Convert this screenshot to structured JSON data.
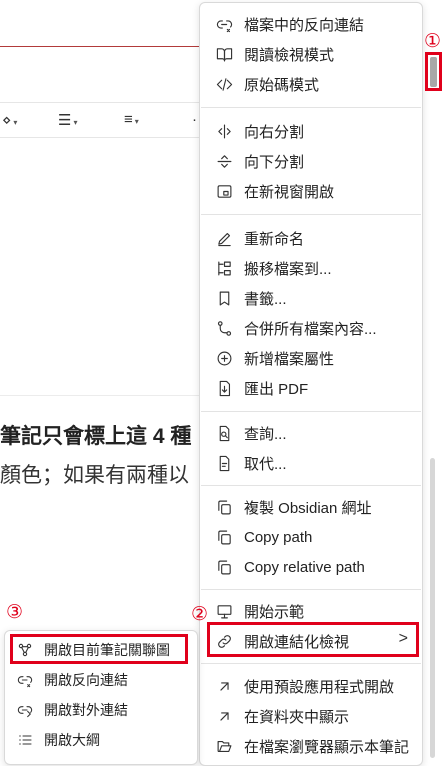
{
  "toolbar": {
    "items": [
      "⋄",
      "☰",
      "≡",
      "·"
    ]
  },
  "document": {
    "line1": "筆記只會標上這 4 種",
    "line2": "顏色；如果有兩種以"
  },
  "menu": {
    "groups": [
      [
        {
          "label": "檔案中的反向連結",
          "icon": "backlink-icon"
        },
        {
          "label": "閱讀檢視模式",
          "icon": "book-open-icon"
        },
        {
          "label": "原始碼模式",
          "icon": "code-icon"
        }
      ],
      [
        {
          "label": "向右分割",
          "icon": "split-right-icon"
        },
        {
          "label": "向下分割",
          "icon": "split-down-icon"
        },
        {
          "label": "在新視窗開啟",
          "icon": "new-window-icon"
        }
      ],
      [
        {
          "label": "重新命名",
          "icon": "pencil-icon"
        },
        {
          "label": "搬移檔案到...",
          "icon": "move-folder-icon"
        },
        {
          "label": "書籤...",
          "icon": "bookmark-icon"
        },
        {
          "label": "合併所有檔案內容...",
          "icon": "merge-icon"
        },
        {
          "label": "新增檔案屬性",
          "icon": "plus-circle-icon"
        },
        {
          "label": "匯出 PDF",
          "icon": "export-pdf-icon"
        }
      ],
      [
        {
          "label": "查詢...",
          "icon": "search-file-icon"
        },
        {
          "label": "取代...",
          "icon": "replace-file-icon"
        }
      ],
      [
        {
          "label": "複製 Obsidian 網址",
          "icon": "copy-icon"
        },
        {
          "label": "Copy path",
          "icon": "copy-icon"
        },
        {
          "label": "Copy relative path",
          "icon": "copy-icon"
        }
      ],
      [
        {
          "label": "開始示範",
          "icon": "presentation-icon"
        },
        {
          "label": "開啟連結化檢視",
          "icon": "link-icon",
          "has_submenu": true,
          "chevron": ">"
        }
      ],
      [
        {
          "label": "使用預設應用程式開啟",
          "icon": "arrow-up-right-icon"
        },
        {
          "label": "在資料夾中顯示",
          "icon": "arrow-up-right-icon"
        },
        {
          "label": "在檔案瀏覽器顯示本筆記",
          "icon": "folder-open-icon"
        }
      ]
    ]
  },
  "submenu": {
    "items": [
      {
        "label": "開啟目前筆記關聯圖",
        "icon": "graph-icon"
      },
      {
        "label": "開啟反向連結",
        "icon": "backlink-icon"
      },
      {
        "label": "開啟對外連結",
        "icon": "outgoing-link-icon"
      },
      {
        "label": "開啟大綱",
        "icon": "outline-list-icon"
      }
    ]
  },
  "annotations": {
    "one": "①",
    "two": "②",
    "three": "③"
  },
  "colors": {
    "highlight": "#e0001b",
    "menu_bg": "#ffffff",
    "separator": "#e3e3e3"
  }
}
